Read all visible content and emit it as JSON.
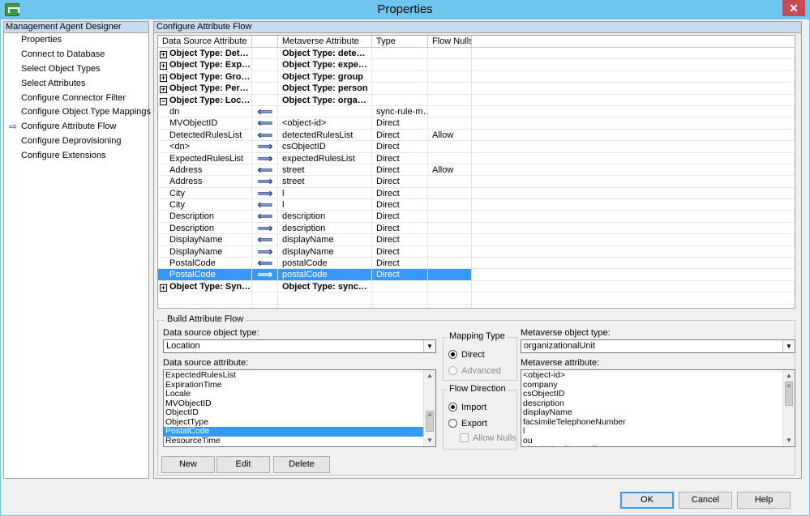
{
  "window": {
    "title": "Properties",
    "close": "✕"
  },
  "left": {
    "header": "Management Agent Designer",
    "items": [
      {
        "label": "Properties"
      },
      {
        "label": "Connect to Database"
      },
      {
        "label": "Select Object Types"
      },
      {
        "label": "Select Attributes"
      },
      {
        "label": "Configure Connector Filter"
      },
      {
        "label": "Configure Object Type Mappings"
      },
      {
        "label": "Configure Attribute Flow",
        "current": true
      },
      {
        "label": "Configure Deprovisioning"
      },
      {
        "label": "Configure Extensions"
      }
    ],
    "current_arrow": "⇨"
  },
  "right": {
    "header": "Configure Attribute Flow",
    "columns": [
      "Data Source Attribute",
      "",
      "Metaverse Attribute",
      "Type",
      "Flow Nulls"
    ],
    "rows": [
      {
        "kind": "group",
        "exp": "+",
        "src": "Object Type: Det…",
        "mv": "Object Type: dete…"
      },
      {
        "kind": "group",
        "exp": "+",
        "src": "Object Type: Exp…",
        "mv": "Object Type: expe…"
      },
      {
        "kind": "group",
        "exp": "+",
        "src": "Object Type: Gro…",
        "mv": "Object Type: group"
      },
      {
        "kind": "group",
        "exp": "+",
        "src": "Object Type: Per…",
        "mv": "Object Type: person"
      },
      {
        "kind": "group",
        "exp": "−",
        "src": "Object Type: Loc…",
        "mv": "Object Type: orga…"
      },
      {
        "src": "dn",
        "dir": "import",
        "mv": "",
        "type": "sync-rule-m…",
        "nulls": ""
      },
      {
        "src": "MVObjectID",
        "dir": "import",
        "mv": "<object-id>",
        "type": "Direct",
        "nulls": ""
      },
      {
        "src": "DetectedRulesList",
        "dir": "import",
        "mv": "detectedRulesList",
        "type": "Direct",
        "nulls": "Allow"
      },
      {
        "src": "<dn>",
        "dir": "export",
        "mv": "csObjectID",
        "type": "Direct",
        "nulls": ""
      },
      {
        "src": "ExpectedRulesList",
        "dir": "export",
        "mv": "expectedRulesList",
        "type": "Direct",
        "nulls": ""
      },
      {
        "src": "Address",
        "dir": "import",
        "mv": "street",
        "type": "Direct",
        "nulls": "Allow"
      },
      {
        "src": "Address",
        "dir": "export",
        "mv": "street",
        "type": "Direct",
        "nulls": ""
      },
      {
        "src": "City",
        "dir": "export",
        "mv": "l",
        "type": "Direct",
        "nulls": ""
      },
      {
        "src": "City",
        "dir": "import",
        "mv": "l",
        "type": "Direct",
        "nulls": ""
      },
      {
        "src": "Description",
        "dir": "import",
        "mv": "description",
        "type": "Direct",
        "nulls": ""
      },
      {
        "src": "Description",
        "dir": "export",
        "mv": "description",
        "type": "Direct",
        "nulls": ""
      },
      {
        "src": "DisplayName",
        "dir": "import",
        "mv": "displayName",
        "type": "Direct",
        "nulls": ""
      },
      {
        "src": "DisplayName",
        "dir": "export",
        "mv": "displayName",
        "type": "Direct",
        "nulls": ""
      },
      {
        "src": "PostalCode",
        "dir": "import",
        "mv": "postalCode",
        "type": "Direct",
        "nulls": ""
      },
      {
        "src": "PostalCode",
        "dir": "export",
        "mv": "postalCode",
        "type": "Direct",
        "nulls": "",
        "selected": true
      },
      {
        "kind": "group",
        "exp": "+",
        "src": "Object Type: Syn…",
        "mv": "Object Type: sync…"
      },
      {
        "kind": "blank"
      }
    ],
    "direction_glyphs": {
      "import": "⟸",
      "export": "⟹"
    }
  },
  "build": {
    "legend": "Build Attribute Flow",
    "ds_type_label": "Data source object type:",
    "ds_type_value": "Location",
    "ds_attr_label": "Data source attribute:",
    "ds_attrs": [
      {
        "label": "ExpectedRulesList"
      },
      {
        "label": "ExpirationTime"
      },
      {
        "label": "Locale"
      },
      {
        "label": "MVObjectID"
      },
      {
        "label": "ObjectID"
      },
      {
        "label": "ObjectType"
      },
      {
        "label": "PostalCode",
        "selected": true
      },
      {
        "label": "ResourceTime"
      }
    ],
    "mapping_type": {
      "legend": "Mapping Type",
      "direct": "Direct",
      "advanced": "Advanced"
    },
    "flow_direction": {
      "legend": "Flow Direction",
      "import": "Import",
      "export": "Export",
      "allow_nulls": "Allow Nulls"
    },
    "mv_type_label": "Metaverse object type:",
    "mv_type_value": "organizationalUnit",
    "mv_attr_label": "Metaverse attribute:",
    "mv_attrs": [
      {
        "label": "<object-id>"
      },
      {
        "label": "company"
      },
      {
        "label": "csObjectID"
      },
      {
        "label": "description"
      },
      {
        "label": "displayName"
      },
      {
        "label": "facsimileTelephoneNumber"
      },
      {
        "label": "l"
      },
      {
        "label": "ou"
      },
      {
        "label": "physicalDeliveryOfficeName"
      }
    ],
    "buttons": {
      "new": "New",
      "edit": "Edit",
      "delete": "Delete"
    }
  },
  "footer": {
    "ok": "OK",
    "cancel": "Cancel",
    "help": "Help"
  },
  "colors": {
    "titlebar": "#6ec6ee",
    "selection": "#3399ff",
    "close": "#c74b50",
    "pane_header": "#c9dbee"
  }
}
